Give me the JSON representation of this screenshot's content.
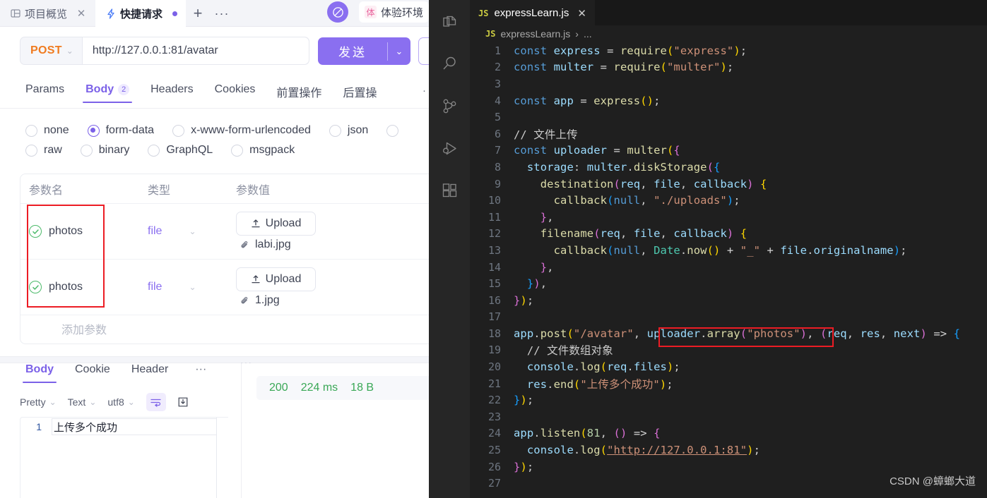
{
  "api_client": {
    "window_tabs": [
      {
        "label": "项目概览",
        "icon": "layout-icon",
        "active": false,
        "closable": true
      },
      {
        "label": "快捷请求",
        "icon": "bolt-icon",
        "active": true,
        "unsaved": true
      }
    ],
    "new_tab_label": "+",
    "tab_overflow_label": "···",
    "environment": {
      "badge_char": "体",
      "name": "体验环境"
    },
    "request": {
      "method": "POST",
      "url": "http://127.0.0.1:81/avatar",
      "send_label": "发送",
      "send_caret": "⌄",
      "method_caret": "⌄"
    },
    "request_tabs": [
      {
        "label": "Params",
        "count": "",
        "active": false
      },
      {
        "label": "Body",
        "count": "2",
        "active": true
      },
      {
        "label": "Headers",
        "count": "",
        "active": false
      },
      {
        "label": "Cookies",
        "count": "",
        "active": false
      },
      {
        "label": "前置操作",
        "count": "",
        "active": false
      },
      {
        "label": "后置操",
        "count": "",
        "active": false
      }
    ],
    "body_types_row1": [
      {
        "label": "none",
        "selected": false
      },
      {
        "label": "form-data",
        "selected": true
      },
      {
        "label": "x-www-form-urlencoded",
        "selected": false
      },
      {
        "label": "json",
        "selected": false
      }
    ],
    "body_types_row2": [
      {
        "label": "raw",
        "selected": false
      },
      {
        "label": "binary",
        "selected": false
      },
      {
        "label": "GraphQL",
        "selected": false
      },
      {
        "label": "msgpack",
        "selected": false
      }
    ],
    "params_table": {
      "headers": [
        "参数名",
        "类型",
        "参数值"
      ],
      "rows": [
        {
          "enabled": true,
          "name": "photos",
          "type": "file",
          "upload_label": "Upload",
          "file": "labi.jpg"
        },
        {
          "enabled": true,
          "name": "photos",
          "type": "file",
          "upload_label": "Upload",
          "file": "1.jpg"
        }
      ],
      "add_row_label": "添加参数"
    },
    "response": {
      "tabs": [
        {
          "label": "Body",
          "active": true
        },
        {
          "label": "Cookie",
          "active": false
        },
        {
          "label": "Header",
          "active": false
        }
      ],
      "tabs_more": "···",
      "toolbar": {
        "format": "Pretty",
        "type": "Text",
        "charset": "utf8",
        "wrap_icon": "word-wrap-icon",
        "download_icon": "download-icon"
      },
      "body_line_number": "1",
      "body_text": "上传多个成功",
      "status": {
        "code": "200",
        "time": "224 ms",
        "size": "18 B"
      },
      "status_color": "#3aa856"
    }
  },
  "vscode": {
    "activity_bar": [
      "explorer-icon",
      "search-icon",
      "source-control-icon",
      "run-debug-icon",
      "extensions-icon"
    ],
    "tab": {
      "label": "expressLearn.js",
      "icon_text": "JS",
      "close": "✕"
    },
    "breadcrumb": {
      "icon_text": "JS",
      "file": "expressLearn.js",
      "sep": "›",
      "rest": "..."
    },
    "highlight_token": "uploader.array(\"photos\")",
    "watermark": "CSDN @蟑螂大道",
    "editor_lines": [
      {
        "n": "1",
        "text": "const express = require(\"express\");"
      },
      {
        "n": "2",
        "text": "const multer = require(\"multer\");"
      },
      {
        "n": "3",
        "text": ""
      },
      {
        "n": "4",
        "text": "const app = express();"
      },
      {
        "n": "5",
        "text": ""
      },
      {
        "n": "6",
        "text": "// 文件上传"
      },
      {
        "n": "7",
        "text": "const uploader = multer({"
      },
      {
        "n": "8",
        "text": "  storage: multer.diskStorage({"
      },
      {
        "n": "9",
        "text": "    destination(req, file, callback) {"
      },
      {
        "n": "10",
        "text": "      callback(null, \"./uploads\");"
      },
      {
        "n": "11",
        "text": "    },"
      },
      {
        "n": "12",
        "text": "    filename(req, file, callback) {"
      },
      {
        "n": "13",
        "text": "      callback(null, Date.now() + \"_\" + file.originalname);"
      },
      {
        "n": "14",
        "text": "    },"
      },
      {
        "n": "15",
        "text": "  }),"
      },
      {
        "n": "16",
        "text": "});"
      },
      {
        "n": "17",
        "text": ""
      },
      {
        "n": "18",
        "text": "app.post(\"/avatar\", uploader.array(\"photos\"), (req, res, next) => {"
      },
      {
        "n": "19",
        "text": "  // 文件数组对象"
      },
      {
        "n": "20",
        "text": "  console.log(req.files);"
      },
      {
        "n": "21",
        "text": "  res.end(\"上传多个成功\");"
      },
      {
        "n": "22",
        "text": "});"
      },
      {
        "n": "23",
        "text": ""
      },
      {
        "n": "24",
        "text": "app.listen(81, () => {"
      },
      {
        "n": "25",
        "text": "  console.log(\"http://127.0.0.1:81\");"
      },
      {
        "n": "26",
        "text": "});"
      },
      {
        "n": "27",
        "text": ""
      }
    ]
  }
}
